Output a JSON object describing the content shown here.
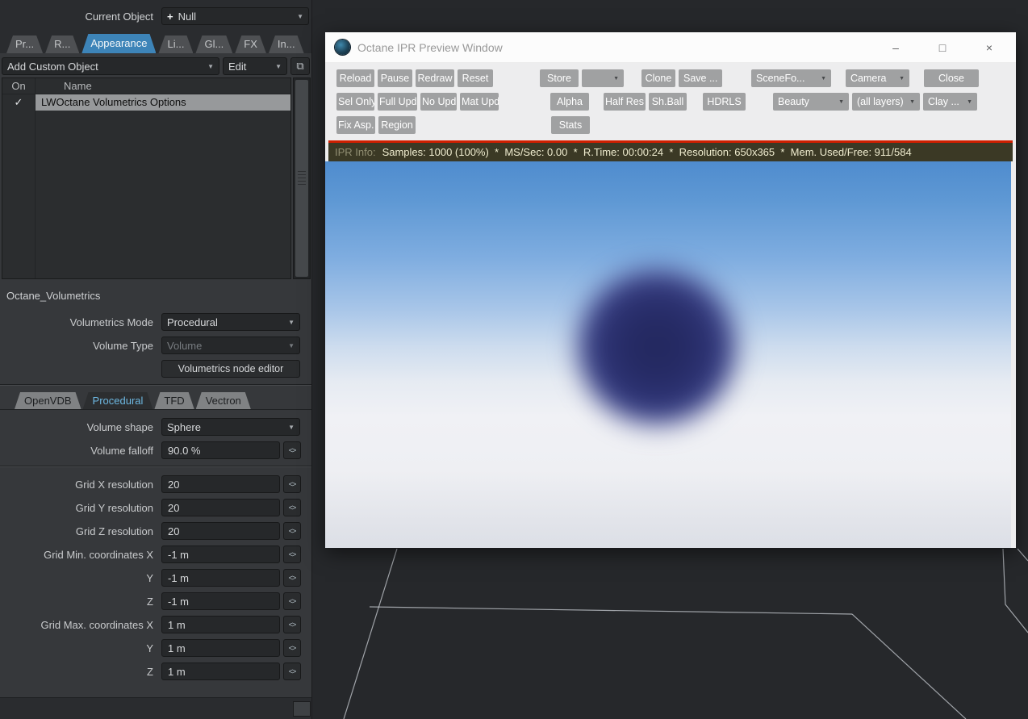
{
  "icons": {
    "chevron_down": "▼",
    "check": "✓",
    "crosshair": "+",
    "clipboard": "⧉",
    "envelope": "<>",
    "minimize": "–",
    "maximize": "□",
    "close": "×"
  },
  "left_panel": {
    "current_object_label": "Current Object",
    "current_object_value": "Null",
    "tabs": [
      {
        "label": "Pr..."
      },
      {
        "label": "R..."
      },
      {
        "label": "Appearance"
      },
      {
        "label": "Li..."
      },
      {
        "label": "Gl..."
      },
      {
        "label": "FX"
      },
      {
        "label": "In..."
      }
    ],
    "add_custom_object_label": "Add Custom Object",
    "edit_label": "Edit",
    "list": {
      "col_on": "On",
      "col_name": "Name",
      "row_name": "LWOctane Volumetrics Options"
    },
    "section_title": "Octane_Volumetrics",
    "volumetrics_mode_label": "Volumetrics Mode",
    "volumetrics_mode_value": "Procedural",
    "volume_type_label": "Volume Type",
    "volume_type_value": "Volume",
    "node_editor_button": "Volumetrics node editor",
    "sub_tabs": [
      {
        "label": "OpenVDB"
      },
      {
        "label": "Procedural"
      },
      {
        "label": "TFD"
      },
      {
        "label": "Vectron"
      }
    ],
    "volume_shape_label": "Volume shape",
    "volume_shape_value": "Sphere",
    "volume_falloff_label": "Volume falloff",
    "volume_falloff_value": "90.0 %",
    "grid_fields": [
      {
        "label": "Grid X resolution",
        "value": "20"
      },
      {
        "label": "Grid Y resolution",
        "value": "20"
      },
      {
        "label": "Grid Z resolution",
        "value": "20"
      },
      {
        "label": "Grid Min. coordinates X",
        "value": "-1 m"
      },
      {
        "label": "Y",
        "value": "-1 m"
      },
      {
        "label": "Z",
        "value": "-1 m"
      },
      {
        "label": "Grid Max. coordinates X",
        "value": "1 m"
      },
      {
        "label": "Y",
        "value": "1 m"
      },
      {
        "label": "Z",
        "value": "1 m"
      }
    ]
  },
  "ipr": {
    "title": "Octane IPR Preview Window",
    "row1": [
      {
        "label": "Reload"
      },
      {
        "label": "Pause"
      },
      {
        "label": "Redraw"
      },
      {
        "label": "Reset"
      },
      {
        "label": "Store"
      },
      {
        "label": ""
      },
      {
        "label": "Clone"
      },
      {
        "label": "Save ..."
      },
      {
        "label": "SceneFo..."
      },
      {
        "label": "Camera"
      },
      {
        "label": "Close"
      }
    ],
    "row2": [
      {
        "label": "Sel Only"
      },
      {
        "label": "Full Upd."
      },
      {
        "label": "No Upd."
      },
      {
        "label": "Mat Upd"
      },
      {
        "label": "Alpha"
      },
      {
        "label": "Half Res"
      },
      {
        "label": "Sh.Ball"
      },
      {
        "label": "HDRLS"
      },
      {
        "label": "Beauty"
      },
      {
        "label": "(all layers)"
      },
      {
        "label": "Clay ..."
      }
    ],
    "row3": [
      {
        "label": "Fix Asp."
      },
      {
        "label": "Region"
      },
      {
        "label": "Stats"
      }
    ],
    "info_label": "IPR Info:",
    "info_text": "Samples: 1000 (100%)  *  MS/Sec: 0.00  *  R.Time: 00:00:24  *  Resolution: 650x365  *  Mem. Used/Free: 911/584"
  }
}
